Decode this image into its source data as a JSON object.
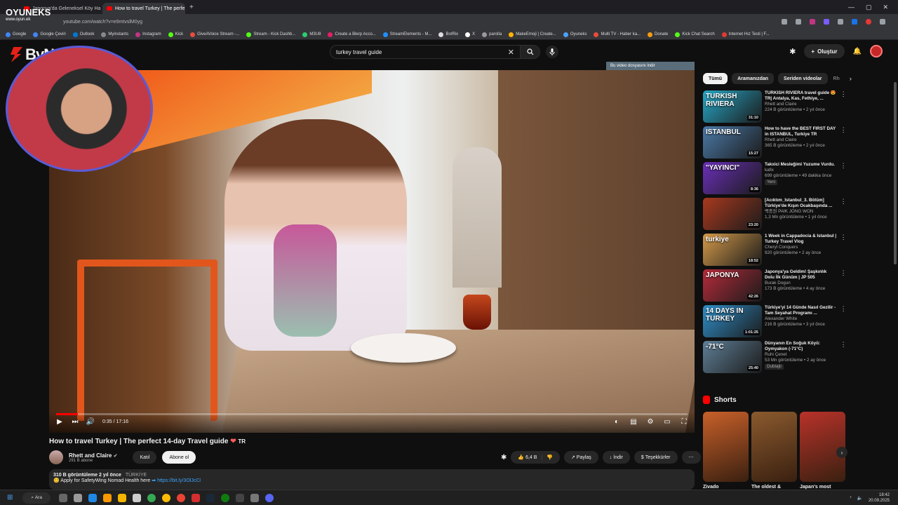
{
  "browser": {
    "tabs": [
      {
        "title": "Japonya'da Geleneksel Köy Ha"
      },
      {
        "title": "How to travel Turkey | The perfe",
        "active": true
      }
    ],
    "url": "youtube.com/watch?v=e9mtvslM0yg",
    "bookmarks": [
      "Google",
      "Google Çeviri",
      "Outlook",
      "Myinstants",
      "Instagram",
      "Kick",
      "GiveAVoice Stream -...",
      "Stream - Kick Dashb...",
      "M3U8",
      "Create a Blerp Acco...",
      "StreamElements - M...",
      "BotRix",
      "X",
      "parolla",
      "MakeEmoji | Create...",
      "Oyuneks",
      "Multi TV - Haber ka...",
      "Donate",
      "Kick Chat Search",
      "Internet Hız Testi | F..."
    ]
  },
  "overlay": {
    "brand": "OYUNEKS",
    "brand_sub": "www.oyun.ek",
    "logo_text": "ByNoGame"
  },
  "header": {
    "search_value": "turkey travel guide",
    "create_label": "Oluştur"
  },
  "player": {
    "download_banner": "Bu video dosyasını indir",
    "time": "0:35 / 17:16",
    "progress": 0.034
  },
  "video": {
    "title": "How to travel Turkey | The perfect 14-day Travel guide",
    "flag_text": "TR",
    "channel": "Rhett and Claire",
    "subs": "291 B abone",
    "join_label": "Katıl",
    "subscribe_label": "Abone ol",
    "likes": "6,4 B",
    "share_label": "Paylaş",
    "download_label": "İndir",
    "thanks_label": "Teşekkürler",
    "views_meta": "310 B görüntüleme  2 yıl önce",
    "location": "TÜRKİYE",
    "desc_line": "Apply for SafetyWing Nomad Health here",
    "desc_link": "https://bit.ly/3OlJcCl"
  },
  "sidebar": {
    "chips": [
      "Tümü",
      "Aramanızdan",
      "Seriden videolar",
      "Rh"
    ],
    "recs": [
      {
        "cap": "TURKISH RIVIERA",
        "title": "TURKISH RIVIERA travel guide 😍TR| Antalya, Kas, Fethiye, ...",
        "channel": "Rhett and Claire",
        "meta": "224 B görüntüleme • 2 yıl önce",
        "dur": "31:10",
        "color": "#27a7c7"
      },
      {
        "cap": "ISTANBUL",
        "title": "How to have the BEST FIRST DAY in ISTANBUL, Turkiye TR",
        "channel": "Rhett and Claire",
        "meta": "365 B görüntüleme • 2 yıl önce",
        "dur": "15:27",
        "color": "#4b7aa8"
      },
      {
        "cap": "\"YAYINCI\"",
        "title": "Takxici Mesleğimi Yuzume Vurdu.",
        "channel": "kafix",
        "meta": "699 görüntüleme • 49 dakika önce",
        "tag": "Yeni",
        "dur": "8:36",
        "color": "#6a2fb8"
      },
      {
        "cap": "",
        "title": "[Acıktım_İstanbul_3. Bölüm] Türkiye'de Kışın Ocakbaşında ...",
        "channel": "백종원 PAIK JONG WON",
        "meta": "1,3 Mn görüntüleme • 1 yıl önce",
        "dur": "23:20",
        "color": "#a8391e"
      },
      {
        "cap": "turkiye",
        "title": "1 Week in Cappadocia & Istanbul | Turkey Travel Vlog",
        "channel": "Cheryl Conquers",
        "meta": "920 görüntüleme • 2 ay önce",
        "dur": "18:52",
        "color": "#d49a4a"
      },
      {
        "cap": "JAPONYA",
        "title": "Japonya'ya Geldim! Şaşkınlık Dolu İlk Günüm | JP 505",
        "channel": "Burak Dogun",
        "meta": "173 B görüntüleme • 4 ay önce",
        "dur": "42:26",
        "color": "#b52b3a"
      },
      {
        "cap": "14 DAYS IN TURKEY",
        "title": "Türkiye'yi 14 Günde Nasıl Gezilir - Tam Seyahat Programı ...",
        "channel": "Alexander White",
        "meta": "216 B görüntüleme • 3 yıl önce",
        "dur": "1:01:25",
        "color": "#2f8fc9"
      },
      {
        "cap": "-71°C",
        "title": "Dünyanın En Soğuk Köyü: Oymyakon (-71°C)",
        "channel": "Ruhi Çenet",
        "meta": "53 Mn görüntüleme • 2 ay önce",
        "tag": "Dublajlı",
        "dur": "25:40",
        "color": "#5f7f96"
      }
    ],
    "shorts_title": "Shorts",
    "shorts": [
      {
        "title": "Zivado",
        "color": "#c8602a"
      },
      {
        "title": "The oldest &",
        "color": "#8a5a2e"
      },
      {
        "title": "Japan's most",
        "color": "#b8322a"
      }
    ]
  },
  "taskbar": {
    "search_label": "Ara",
    "time": "18:42",
    "date": "20.09.2025"
  }
}
